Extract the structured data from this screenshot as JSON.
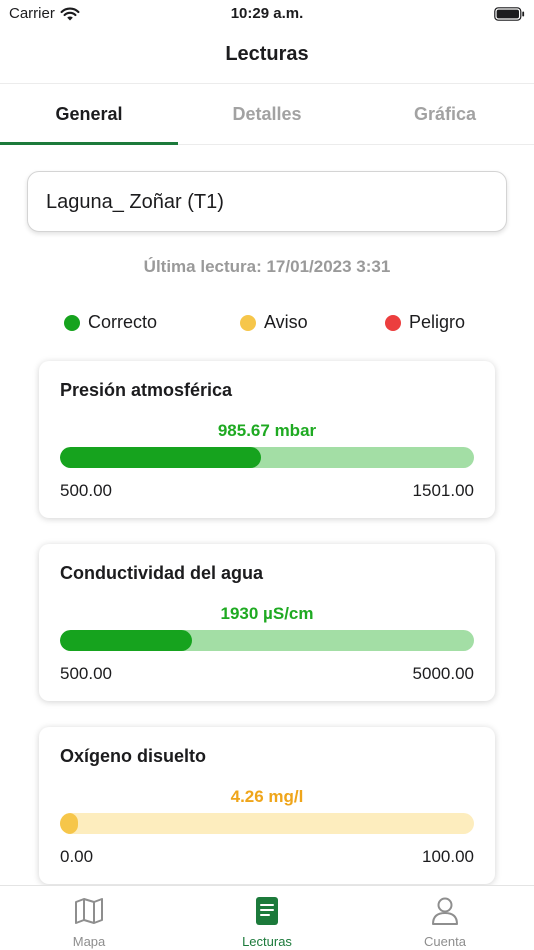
{
  "status_bar": {
    "carrier": "Carrier",
    "time": "10:29 a.m."
  },
  "nav": {
    "title": "Lecturas"
  },
  "tabs": [
    {
      "label": "General",
      "active": true
    },
    {
      "label": "Detalles",
      "active": false
    },
    {
      "label": "Gráfica",
      "active": false
    }
  ],
  "station": {
    "name": "Laguna_ Zoñar (T1)"
  },
  "last_reading": "Última lectura: 17/01/2023 3:31",
  "legend": [
    {
      "label": "Correcto",
      "color": "#16a31e"
    },
    {
      "label": "Aviso",
      "color": "#f6c64a"
    },
    {
      "label": "Peligro",
      "color": "#ec3e3e"
    }
  ],
  "readings": [
    {
      "title": "Presión atmosférica",
      "value": "985.67 mbar",
      "min": "500.00",
      "max": "1501.00",
      "fill_fraction": 0.485,
      "status": "correcto",
      "value_color": "#1faa22",
      "fill_color": "#16a31e",
      "track_color": "#a3deA5"
    },
    {
      "title": "Conductividad del agua",
      "value": "1930 µS/cm",
      "min": "500.00",
      "max": "5000.00",
      "fill_fraction": 0.318,
      "status": "correcto",
      "value_color": "#1faa22",
      "fill_color": "#16a31e",
      "track_color": "#a3dea5"
    },
    {
      "title": "Oxígeno disuelto",
      "value": "4.26 mg/l",
      "min": "0.00",
      "max": "100.00",
      "fill_fraction": 0.0426,
      "status": "aviso",
      "value_color": "#efa51a",
      "fill_color": "#f6c64a",
      "track_color": "#fdedbe"
    }
  ],
  "tabbar": [
    {
      "label": "Mapa",
      "icon": "map-icon",
      "active": false
    },
    {
      "label": "Lecturas",
      "icon": "document-icon",
      "active": true
    },
    {
      "label": "Cuenta",
      "icon": "person-icon",
      "active": false
    }
  ],
  "accent_color": "#1c7a3b"
}
